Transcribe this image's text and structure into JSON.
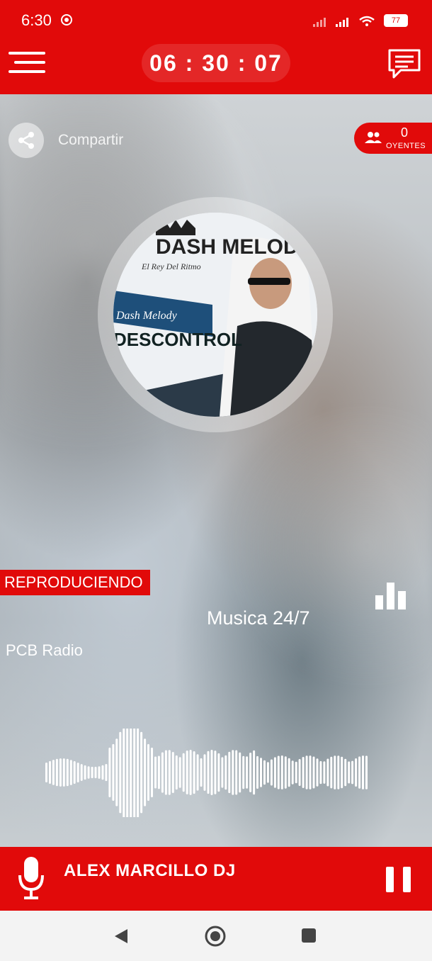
{
  "status_bar": {
    "time": "6:30",
    "battery": "77",
    "icons": [
      "chrome-icon",
      "signal-icon",
      "signal-icon",
      "wifi-icon",
      "battery-icon"
    ]
  },
  "header": {
    "clock": "06 : 30 : 07",
    "menu_icon": "hamburger-menu-icon",
    "chat_icon": "chat-icon",
    "accent_color": "#e10a0a"
  },
  "main": {
    "share_label": "Compartir",
    "listeners_count": "0",
    "listeners_label": "OYENTES",
    "album_art": {
      "line1": "DASH MELODY",
      "line2": "El Rey Del Ritmo",
      "line3": "Dash Melody",
      "line4": "DESCONTROL"
    },
    "now_playing_label": "REPRODUCIENDO",
    "song_title": "Musica 24/7",
    "station": "PCB Radio"
  },
  "player": {
    "dj_name": "ALEX MARCILLO DJ",
    "state": "playing"
  },
  "navbar": {
    "icons": [
      "back-icon",
      "home-icon",
      "recents-icon"
    ]
  }
}
